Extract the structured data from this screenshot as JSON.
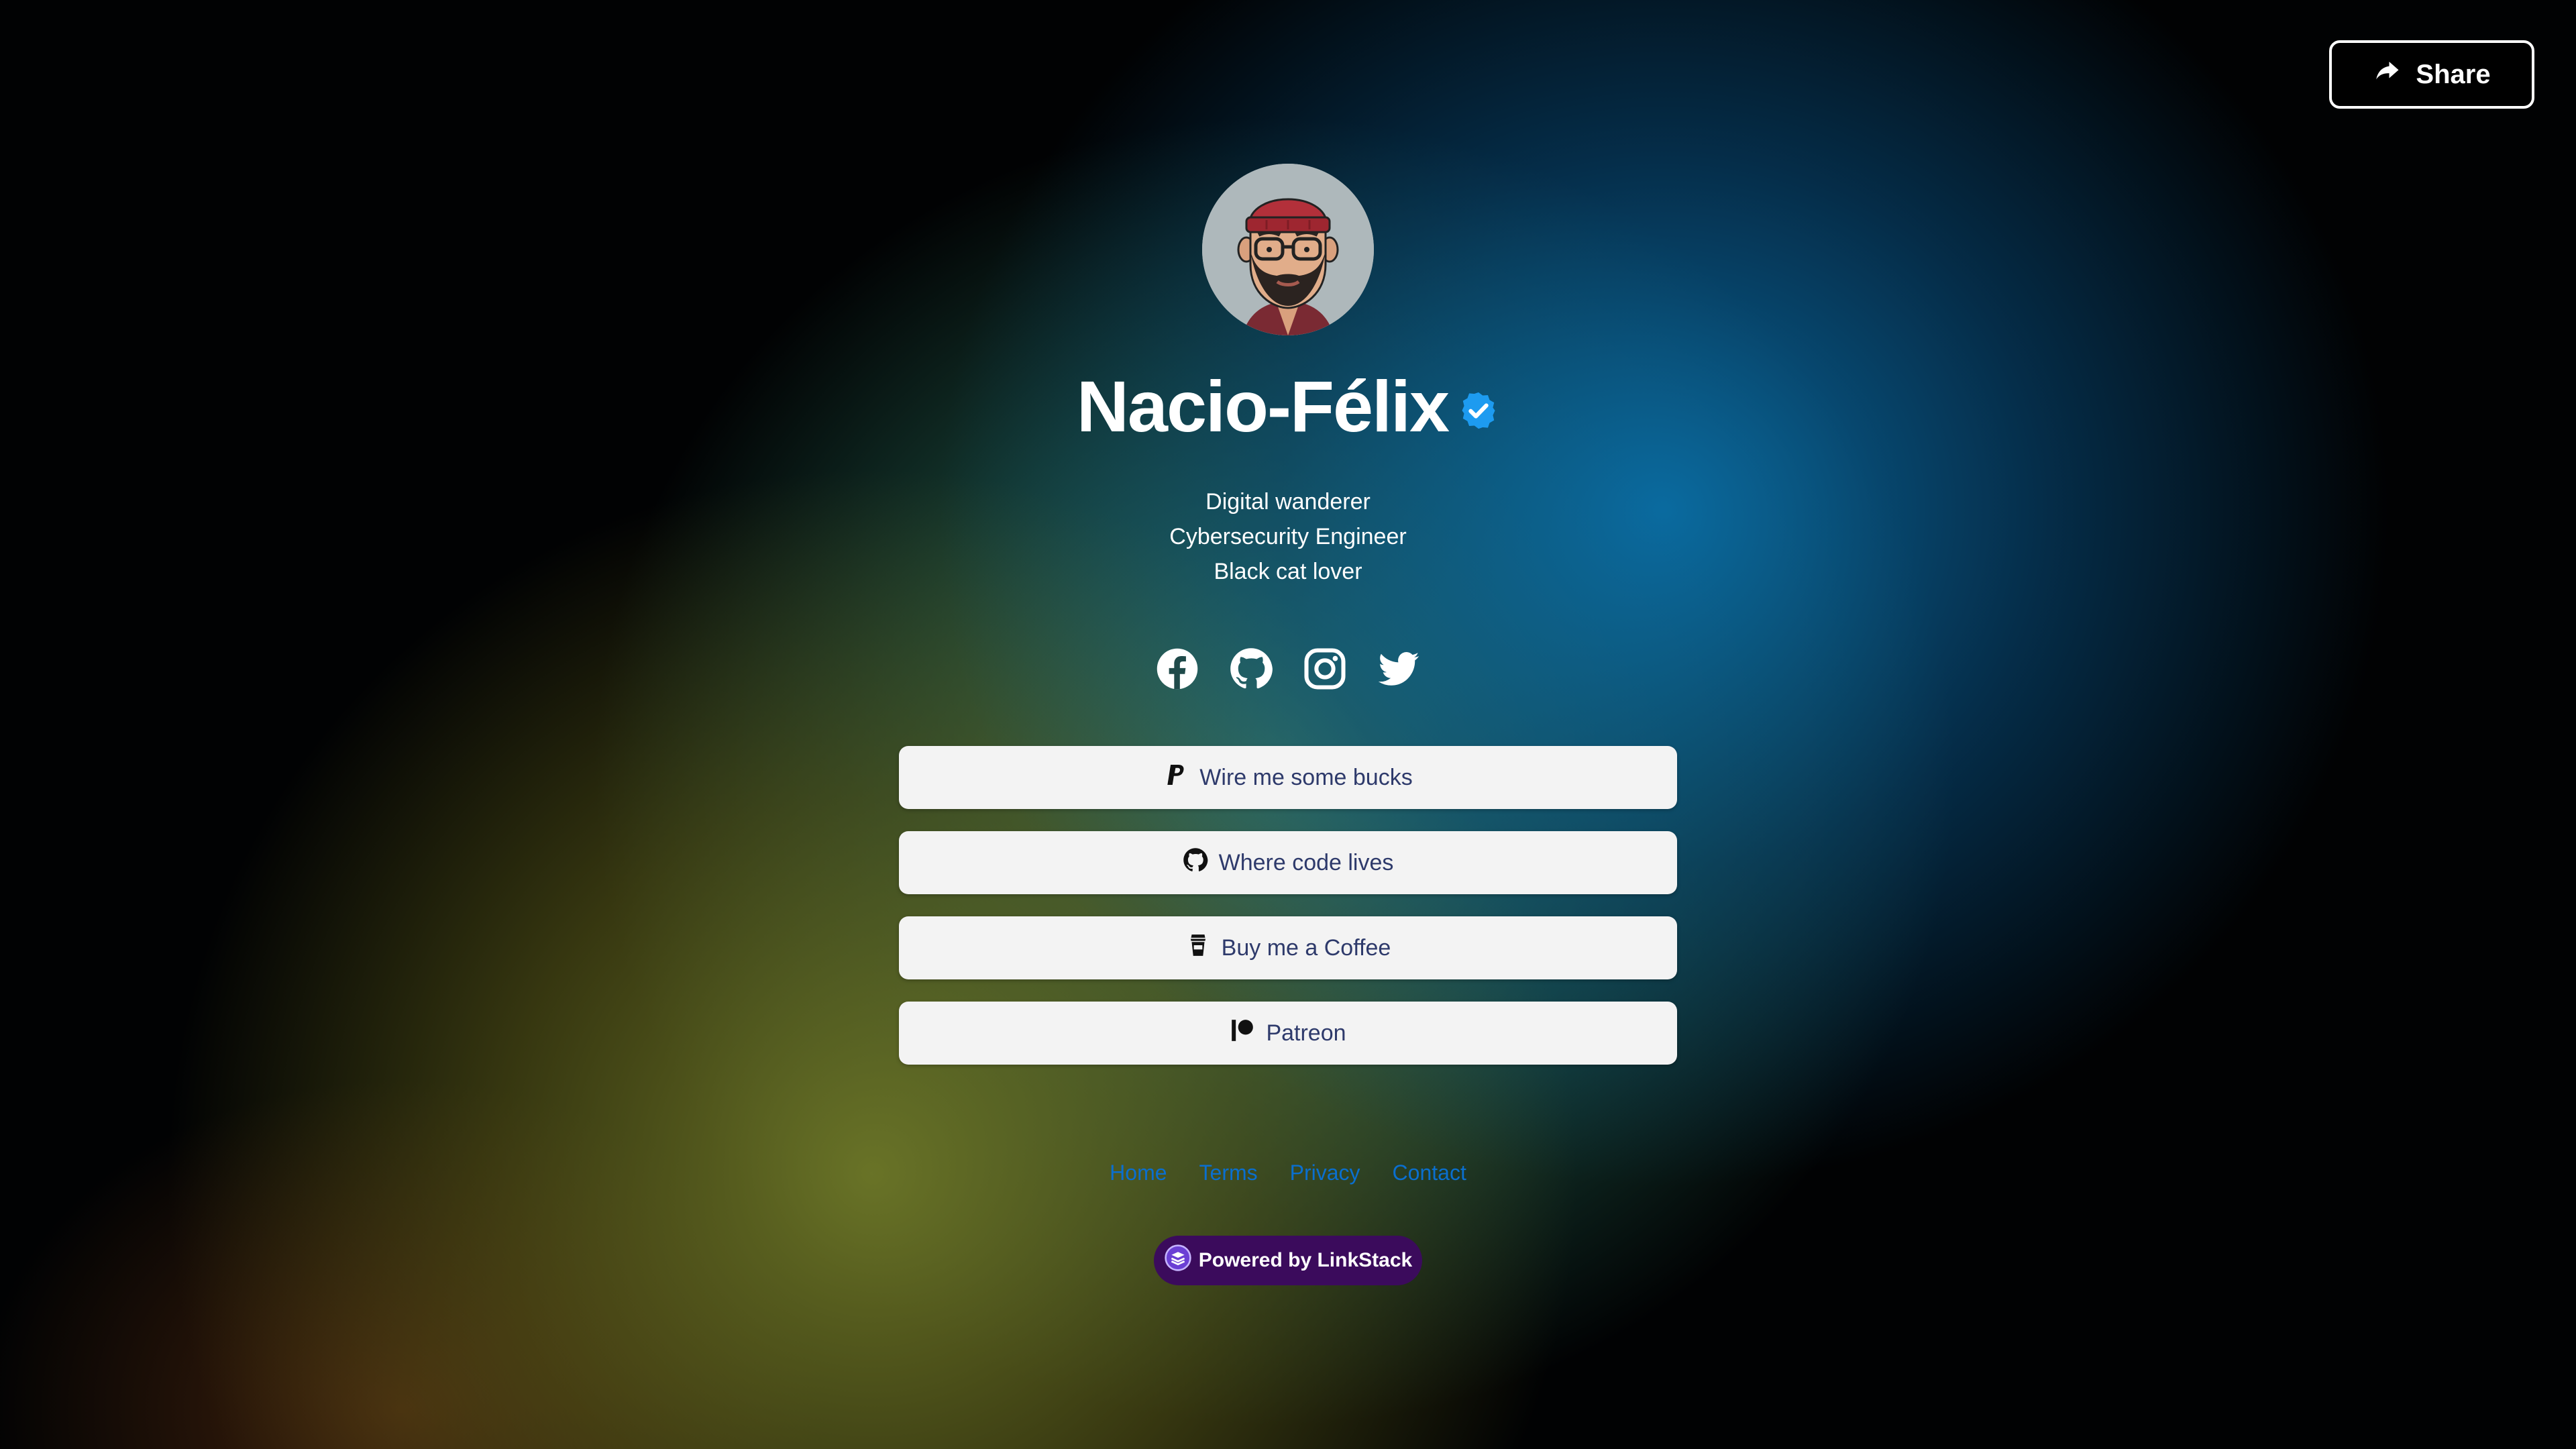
{
  "share": {
    "label": "Share",
    "icon": "share-icon"
  },
  "profile": {
    "name": "Nacio-Félix",
    "verified_icon": "verified-badge-icon",
    "bio": [
      "Digital wanderer",
      "Cybersecurity Engineer",
      "Black cat lover"
    ]
  },
  "socials": [
    {
      "name": "facebook-icon"
    },
    {
      "name": "github-icon"
    },
    {
      "name": "instagram-icon"
    },
    {
      "name": "twitter-icon"
    }
  ],
  "links": [
    {
      "label": "Wire me some bucks",
      "icon": "paypal-icon"
    },
    {
      "label": "Where code lives",
      "icon": "github-icon"
    },
    {
      "label": "Buy me a Coffee",
      "icon": "coffee-cup-icon"
    },
    {
      "label": "Patreon",
      "icon": "patreon-icon"
    }
  ],
  "footer": {
    "home": "Home",
    "terms": "Terms",
    "privacy": "Privacy",
    "contact": "Contact"
  },
  "powered_by": "Powered by LinkStack",
  "colors": {
    "link_button_bg": "#f3f3f3",
    "link_text": "#2e3a6b",
    "footer_link": "#0a6fcf",
    "badge_bg": "#3b0b5c",
    "verified": "#1d9bf0"
  }
}
